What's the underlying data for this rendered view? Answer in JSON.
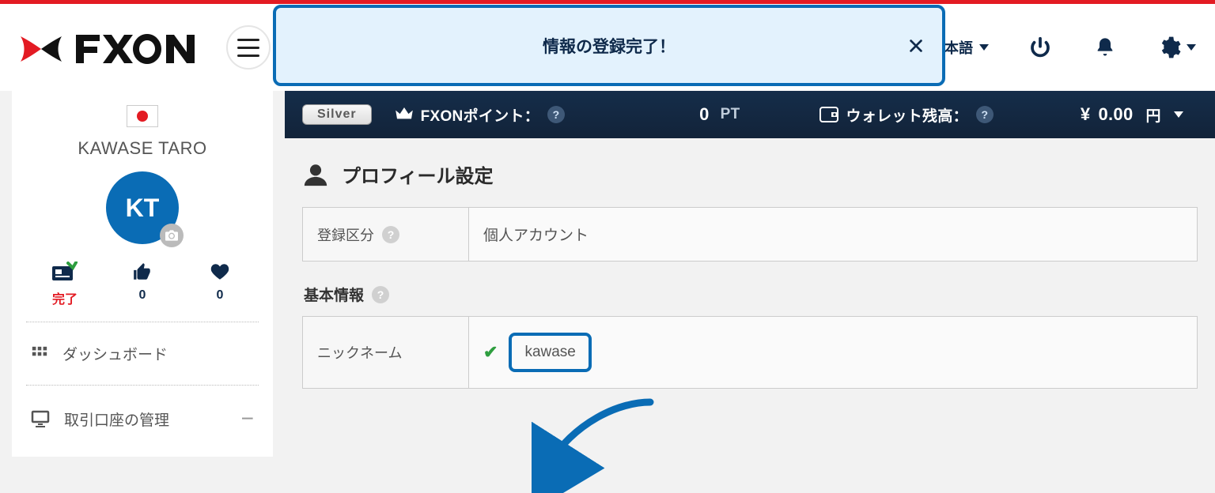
{
  "banner": {
    "message": "情報の登録完了！"
  },
  "header": {
    "language": "日本語"
  },
  "user": {
    "display_name": "KAWASE TARO",
    "initials": "KT"
  },
  "stats": {
    "status_label": "完了",
    "thumbs": "0",
    "likes": "0"
  },
  "sidebar": {
    "items": [
      {
        "label": "ダッシュボード"
      },
      {
        "label": "取引口座の管理"
      }
    ]
  },
  "statusbar": {
    "tier": "Silver",
    "points_label": "FXONポイント：",
    "points_value": "0",
    "points_unit": "PT",
    "wallet_label": "ウォレット残高：",
    "currency_symbol": "¥",
    "wallet_amount": "0.00",
    "wallet_unit": "円"
  },
  "page": {
    "title": "プロフィール設定",
    "reg_type_label": "登録区分",
    "reg_type_value": "個人アカウント",
    "section_basic": "基本情報",
    "nickname_label": "ニックネーム",
    "nickname_value": "kawase"
  }
}
